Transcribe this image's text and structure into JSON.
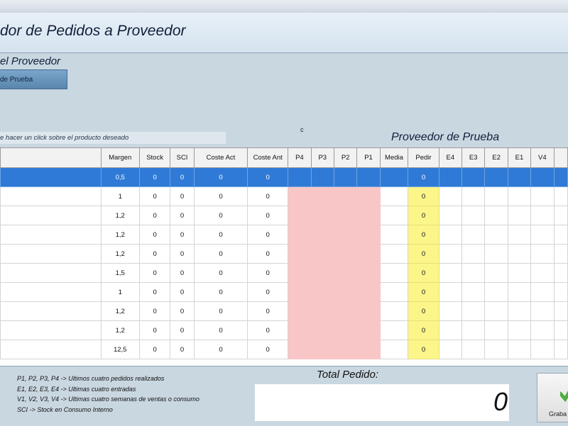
{
  "window": {
    "title": "dor de Pedidos a Proveedor"
  },
  "supplier_section": {
    "label": "el Proveedor",
    "button_label": "de Prueba",
    "hint": "e hacer un click sobre el producto deseado",
    "stray_text": "c",
    "supplier_name": "Proveedor de Prueba"
  },
  "grid": {
    "columns": [
      "",
      "Margen",
      "Stock",
      "SCI",
      "Coste Act",
      "Coste Ant",
      "P4",
      "P3",
      "P2",
      "P1",
      "Media",
      "Pedir",
      "E4",
      "E3",
      "E2",
      "E1",
      "V4"
    ],
    "rows": [
      {
        "margen": "0,5",
        "stock": "0",
        "sci": "0",
        "coste_act": "0",
        "coste_ant": "0",
        "pedir": "0"
      },
      {
        "margen": "1",
        "stock": "0",
        "sci": "0",
        "coste_act": "0",
        "coste_ant": "0",
        "pedir": "0"
      },
      {
        "margen": "1,2",
        "stock": "0",
        "sci": "0",
        "coste_act": "0",
        "coste_ant": "0",
        "pedir": "0"
      },
      {
        "margen": "1,2",
        "stock": "0",
        "sci": "0",
        "coste_act": "0",
        "coste_ant": "0",
        "pedir": "0"
      },
      {
        "margen": "1,2",
        "stock": "0",
        "sci": "0",
        "coste_act": "0",
        "coste_ant": "0",
        "pedir": "0"
      },
      {
        "margen": "1,5",
        "stock": "0",
        "sci": "0",
        "coste_act": "0",
        "coste_ant": "0",
        "pedir": "0"
      },
      {
        "margen": "1",
        "stock": "0",
        "sci": "0",
        "coste_act": "0",
        "coste_ant": "0",
        "pedir": "0"
      },
      {
        "margen": "1,2",
        "stock": "0",
        "sci": "0",
        "coste_act": "0",
        "coste_ant": "0",
        "pedir": "0"
      },
      {
        "margen": "1,2",
        "stock": "0",
        "sci": "0",
        "coste_act": "0",
        "coste_ant": "0",
        "pedir": "0"
      },
      {
        "margen": "12,5",
        "stock": "0",
        "sci": "0",
        "coste_act": "0",
        "coste_ant": "0",
        "pedir": "0"
      }
    ]
  },
  "legend": [
    "P1, P2, P3, P4 -> Ultimos cuatro pedidos realizados",
    "E1, E2, E3, E4 -> Ultimas cuatro entradas",
    "V1, V2, V3, V4 -> Ultimas cuatro semanas de ventas o consumo",
    "SCI -> Stock en Consumo Interno"
  ],
  "total": {
    "label": "Total Pedido:",
    "value": "0"
  },
  "save_button": {
    "label": "Graba",
    "icon": "checkmark-icon"
  },
  "colors": {
    "selected_row": "#2f7ad6",
    "p_columns": "#f8c6c6",
    "pedir_column": "#fbf58a",
    "save_check": "#4caf3f"
  }
}
